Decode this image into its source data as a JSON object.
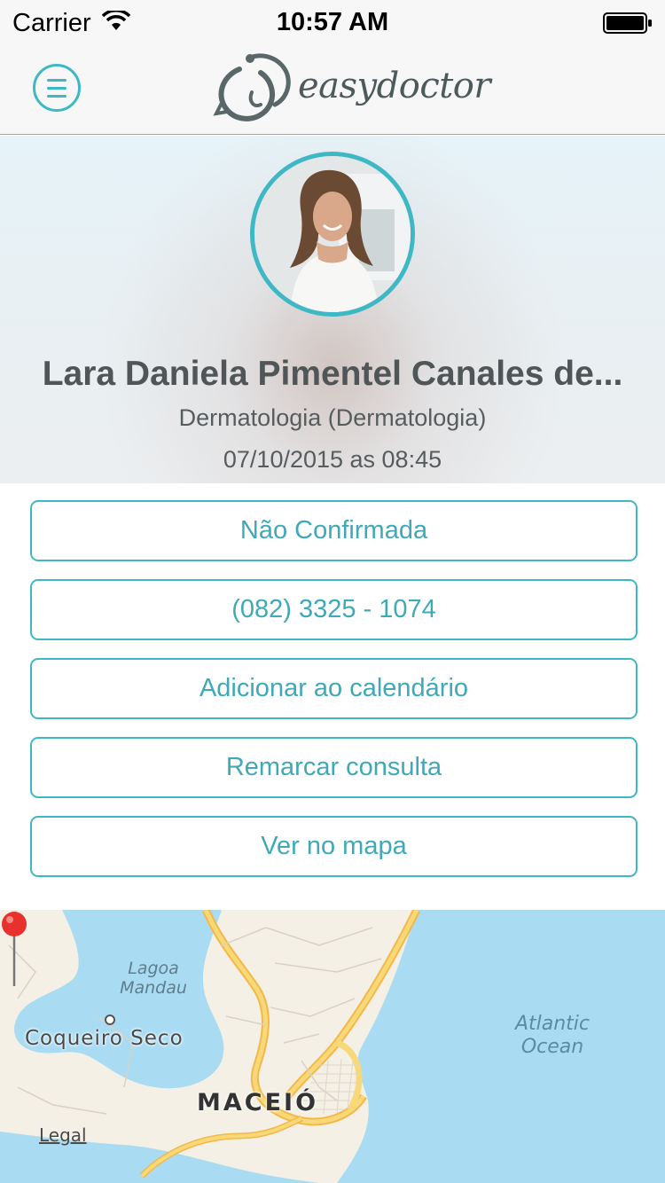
{
  "status_bar": {
    "carrier": "Carrier",
    "time": "10:57 AM"
  },
  "nav": {
    "logo_text": "easydoctor",
    "menu_icon": "hamburger-menu-icon"
  },
  "profile": {
    "name": "Lara Daniela Pimentel Canales de...",
    "specialty": "Dermatologia (Dermatologia)",
    "datetime": "07/10/2015 as 08:45"
  },
  "actions": [
    {
      "label": "Não Confirmada"
    },
    {
      "label": "(082) 3325 - 1074"
    },
    {
      "label": "Adicionar ao calendário"
    },
    {
      "label": "Remarcar consulta"
    },
    {
      "label": "Ver no mapa"
    }
  ],
  "map": {
    "labels": {
      "lagoa_line1": "Lagoa",
      "lagoa_line2": "Mandau",
      "coqueiro": "Coqueiro Seco",
      "city": "MACEIÓ",
      "ocean_line1": "Atlantic",
      "ocean_line2": "Ocean",
      "legal": "Legal"
    }
  },
  "colors": {
    "accent": "#3fb8c6",
    "button_text": "#3fa9b7",
    "water": "#a9dcf3",
    "land": "#f4f0e6",
    "road": "#f6c84a",
    "pin": "#e8312c"
  }
}
